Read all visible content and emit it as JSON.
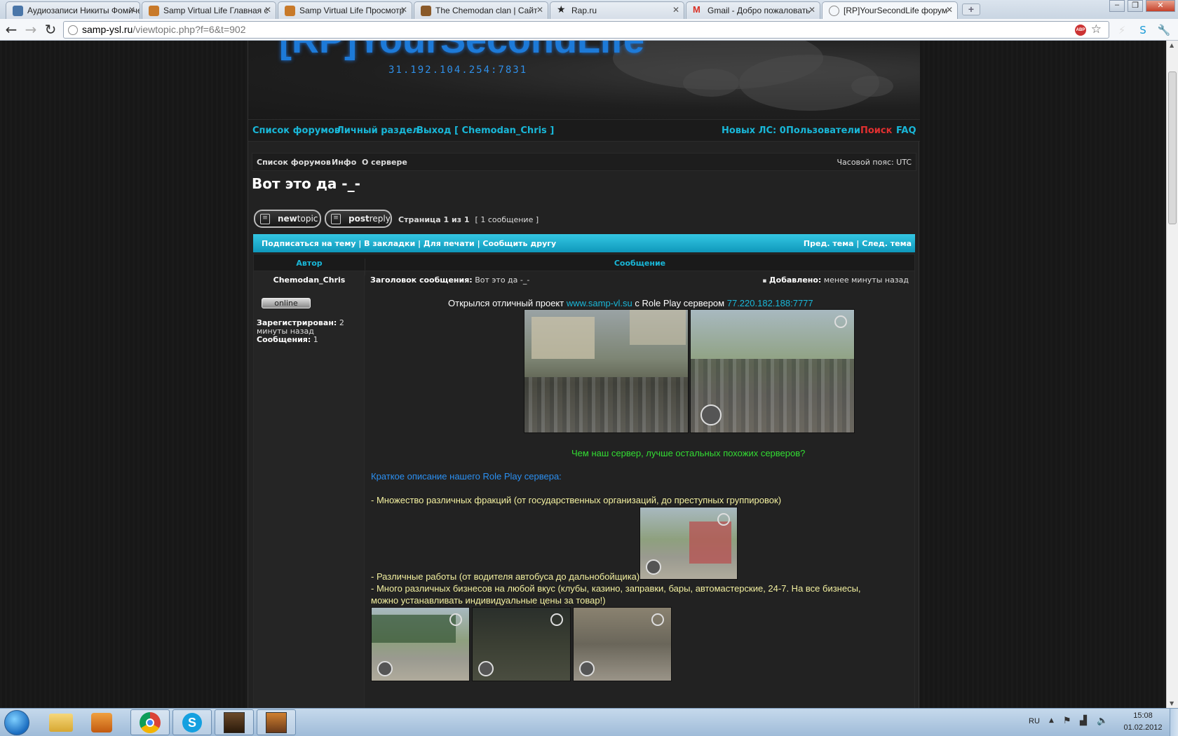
{
  "browser": {
    "tabs": [
      {
        "title": "Аудиозаписи Никиты Фомичева",
        "favicon_color": "#4a76a8"
      },
      {
        "title": "Samp Virtual Life Главная с",
        "favicon_color": "#c87a2a"
      },
      {
        "title": "Samp Virtual Life Просмотр",
        "favicon_color": "#c87a2a"
      },
      {
        "title": "The Chemodan clan | Сайт",
        "favicon_color": "#8a5a2a"
      },
      {
        "title": "Rap.ru",
        "favicon_color": "#222222"
      },
      {
        "title": "Gmail - Добро пожаловать",
        "favicon_color": "#d93025"
      },
      {
        "title": "[RP]YourSecondLife форум",
        "favicon_color": "#888888"
      }
    ],
    "url_host": "samp-ysl.ru",
    "url_path": "/viewtopic.php?f=6&t=902"
  },
  "header": {
    "logo_text": "[RP]YourSecondLife",
    "server_ip": "31.192.104.254:7831"
  },
  "nav": {
    "forum_list": "Список форумов",
    "personal": "Личный раздел",
    "logout": "Выход [ Chemodan_Chris ]",
    "new_pm": "Новых ЛС: 0",
    "users": "Пользователи",
    "search": "Поиск",
    "faq": "FAQ"
  },
  "breadcrumbs": {
    "forum_list": "Список форумов",
    "info": "Инфо",
    "about": "О сервере",
    "timezone": "Часовой пояс: UTC"
  },
  "topic": {
    "title": "Вот это да -_-",
    "new_topic_bold": "new",
    "new_topic_rest": "topic",
    "post_reply_bold": "post",
    "post_reply_rest": "reply",
    "page_info": "Страница 1 из 1",
    "post_count": "[ 1 сообщение ]",
    "actions_left": "Подписаться на тему | В закладки | Для печати | Сообщить другу",
    "actions_right": "Пред. тема | След. тема",
    "col_author": "Автор",
    "col_message": "Сообщение"
  },
  "post": {
    "author": "Chemodan_Chris",
    "online": "online",
    "registered_label": "Зарегистрирован:",
    "registered_value": "2 минуты назад",
    "posts_label": "Сообщения:",
    "posts_value": "1",
    "subject_label": "Заголовок сообщения:",
    "subject_value": "Вот это да -_-",
    "added_label": "Добавлено:",
    "added_value": "менее минуты назад",
    "intro_1": "Открылся отличный проект",
    "intro_link": "www.samp-vl.su",
    "intro_2": "с Role Play сервером",
    "intro_ip": "77.220.182.188:7777",
    "question": "Чем наш сервер, лучше остальных похожих серверов?",
    "desc_heading": "Краткое описание нашего Role Play сервера:",
    "bullet_1": "- Множество различных фракций (от государственных организаций, до преступных группировок)",
    "bullet_2": "- Различные работы (от водителя автобуса до дальнобойщика)",
    "bullet_3a": "- Много различных бизнесов на любой вкус (клубы, казино, заправки, бары, автомастерские, 24-7. На все бизнесы,",
    "bullet_3b": "можно устанавливать индивидуальные цены за товар!)"
  },
  "taskbar": {
    "lang": "RU",
    "time": "15:08",
    "date": "01.02.2012"
  }
}
